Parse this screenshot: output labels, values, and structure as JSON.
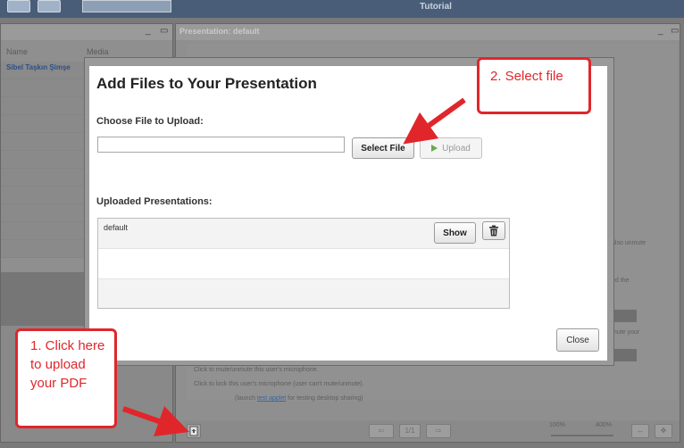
{
  "topbar": {
    "title": "Tutorial"
  },
  "users_panel": {
    "col_name": "Name",
    "col_media": "Media",
    "first_user": "Sibel Taşkın Şimşe"
  },
  "presentation_panel": {
    "title": "Presentation: default",
    "bg_text_1": "also unmute",
    "bg_text_2": "ed the",
    "bg_text_3": "mute your",
    "bg_text_4": "Click to mute/unmute this user's microphone.",
    "bg_text_5": "Click to lock this user's microphone (user can't mute/unmute).",
    "bg_text_6_pre": "(launch ",
    "bg_text_6_link": "test applet",
    "bg_text_6_post": " for testing desktop sharing)",
    "page_indicator": "1/1",
    "zoom_min": "100%",
    "zoom_max": "400%"
  },
  "modal": {
    "title": "Add Files to Your Presentation",
    "choose_label": "Choose File to Upload:",
    "file_input_value": "",
    "select_file_label": "Select File",
    "upload_label": "Upload",
    "uploaded_label": "Uploaded Presentations:",
    "presentations": [
      {
        "name": "default",
        "show_label": "Show"
      }
    ],
    "close_label": "Close"
  },
  "annotations": {
    "select_step": "2. Select file",
    "upload_step": "1. Click here to upload your PDF",
    "color": "#e0262b"
  }
}
